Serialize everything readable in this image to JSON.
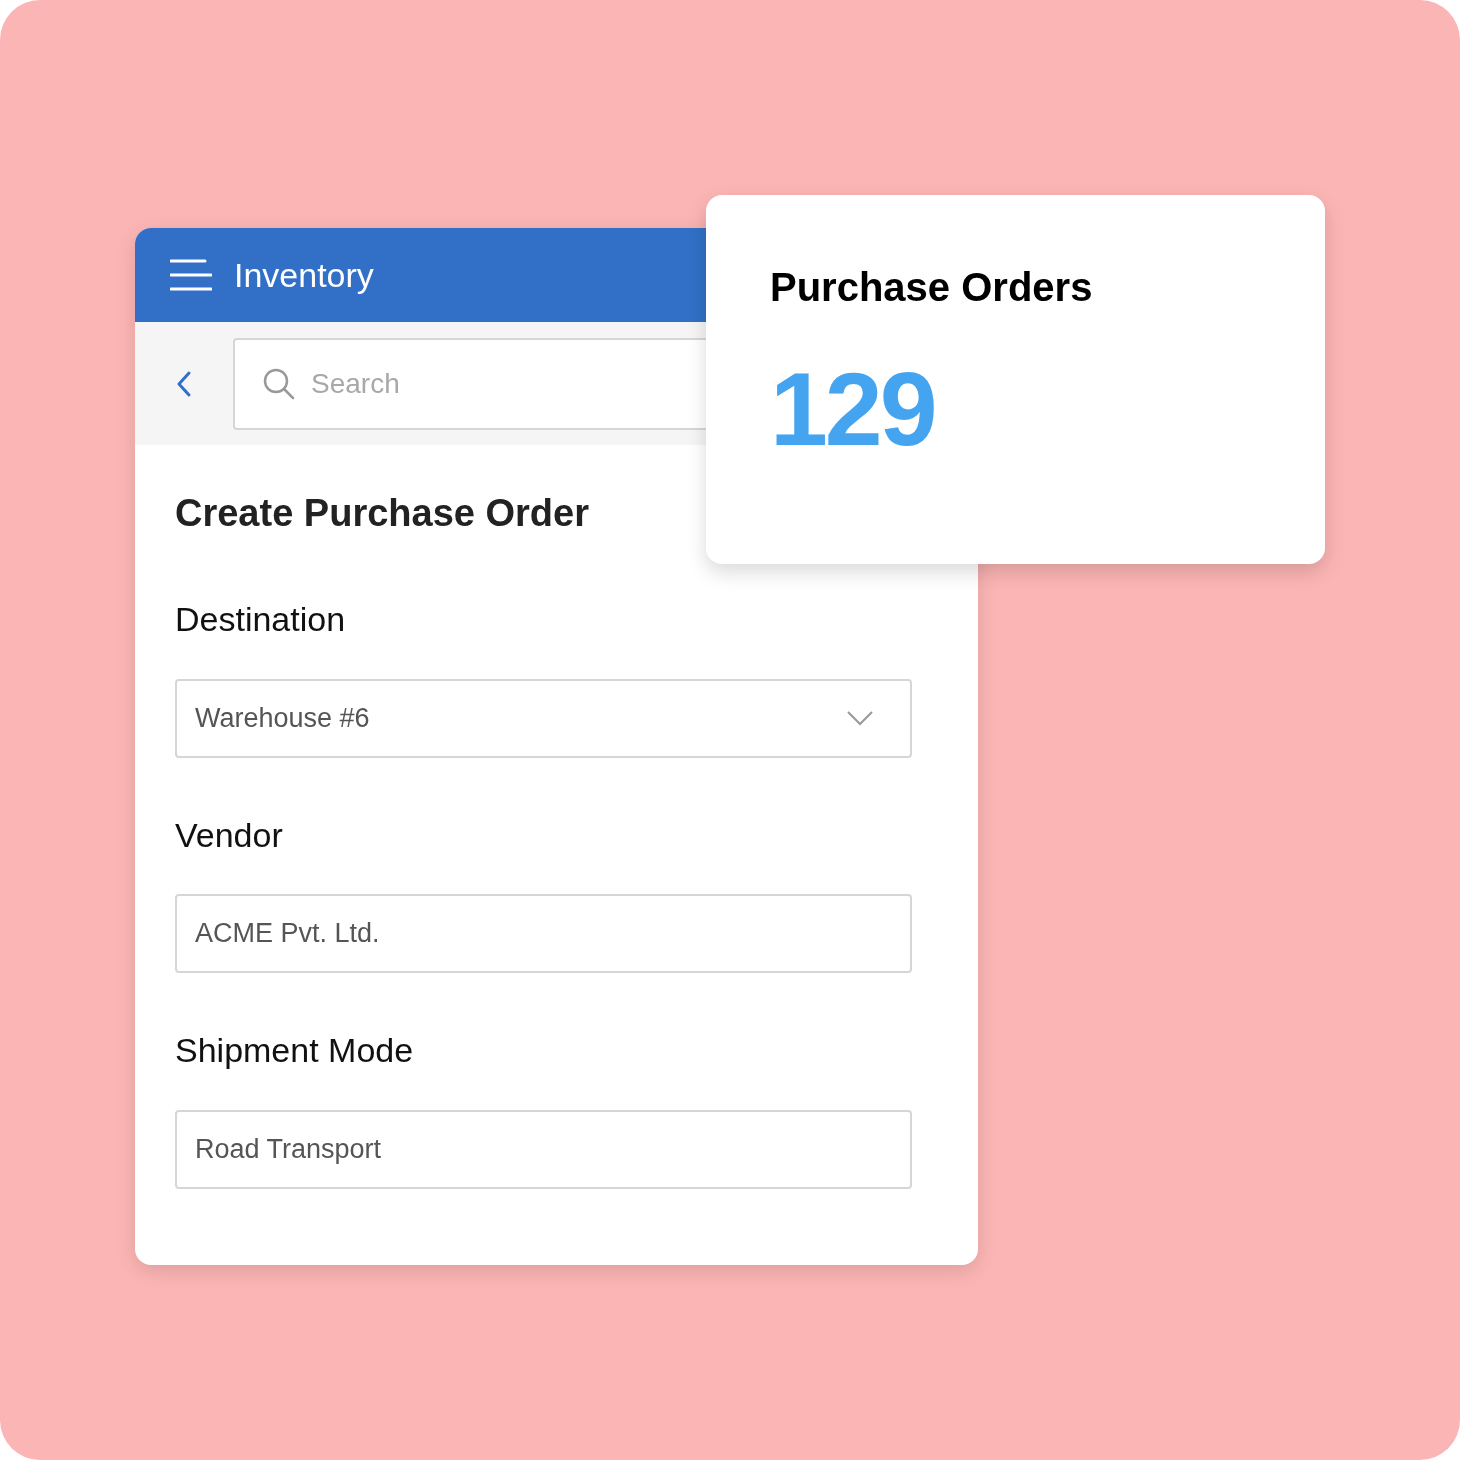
{
  "header": {
    "title": "Inventory"
  },
  "search": {
    "placeholder": "Search"
  },
  "form": {
    "title": "Create Purchase Order",
    "fields": [
      {
        "label": "Destination",
        "value": "Warehouse #6",
        "kind": "dropdown"
      },
      {
        "label": "Vendor",
        "value": "ACME Pvt. Ltd.",
        "kind": "text"
      },
      {
        "label": "Shipment Mode",
        "value": "Road Transport",
        "kind": "text"
      }
    ]
  },
  "stat_card": {
    "title": "Purchase Orders",
    "value": "129"
  }
}
